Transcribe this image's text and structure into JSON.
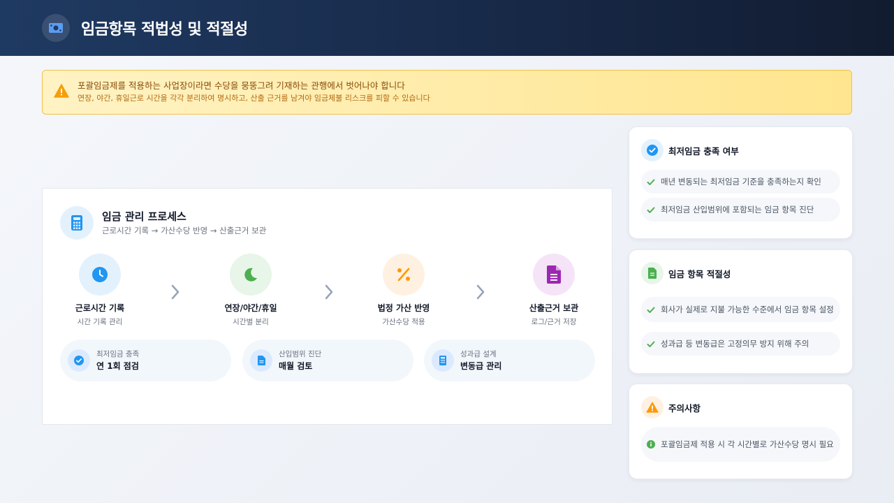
{
  "header": {
    "title": "임금항목 적법성 및 적절성",
    "icon": "money-bill-icon"
  },
  "alert": {
    "icon": "warning-icon",
    "title": "포괄임금제를 적용하는 사업장이라면 수당을 뭉뚱그려 기재하는 관행에서 벗어나야 합니다",
    "subtitle": "연장, 야간, 휴일근로 시간을 각각 분리하여 명시하고, 산출 근거를 남겨야 임금체불 리스크를 피할 수 있습니다"
  },
  "process": {
    "icon": "calculator-icon",
    "title": "임금 관리 프로세스",
    "subtitle": "근로시간 기록 → 가산수당 반영 → 산출근거 보관",
    "steps": [
      {
        "label": "근로시간 기록",
        "desc": "시간 기록 관리",
        "icon": "clock-icon"
      },
      {
        "label": "연장/야간/휴일",
        "desc": "시간별 분리",
        "icon": "moon-icon"
      },
      {
        "label": "법정 가산 반영",
        "desc": "가산수당 적용",
        "icon": "percent-icon"
      },
      {
        "label": "산출근거 보관",
        "desc": "로그/근거 저장",
        "icon": "document-icon"
      }
    ],
    "pills": [
      {
        "sub": "최저임금 충족",
        "main": "연 1회 점검",
        "icon": "check-circle-icon"
      },
      {
        "sub": "산입범위 진단",
        "main": "매월 검토",
        "icon": "document-icon"
      },
      {
        "sub": "성과급 설계",
        "main": "변동급 관리",
        "icon": "calculator-icon"
      }
    ]
  },
  "cards": {
    "min_wage": {
      "title": "최저임금 충족 여부",
      "icon": "check-circle-icon",
      "items": [
        "매년 변동되는 최저임금 기준을 충족하는지 확인",
        "최저임금 산입범위에 포함되는 임금 항목 진단"
      ]
    },
    "wage_items": {
      "title": "임금 항목 적절성",
      "icon": "document-icon",
      "items": [
        "회사가 실제로 지불 가능한 수준에서 임금 항목 설정",
        "성과급 등 변동급은 고정의무 방지 위해 주의"
      ]
    },
    "caution": {
      "title": "주의사항",
      "icon": "warning-icon",
      "items": [
        "포괄임금제 적용 시 각 시간별로 가산수당 명시 필요"
      ]
    }
  },
  "colors": {
    "header_bg": "#1f3a62",
    "blue": "#2196f3",
    "green": "#4caf50",
    "orange": "#ff9800",
    "purple": "#9c27b0"
  }
}
